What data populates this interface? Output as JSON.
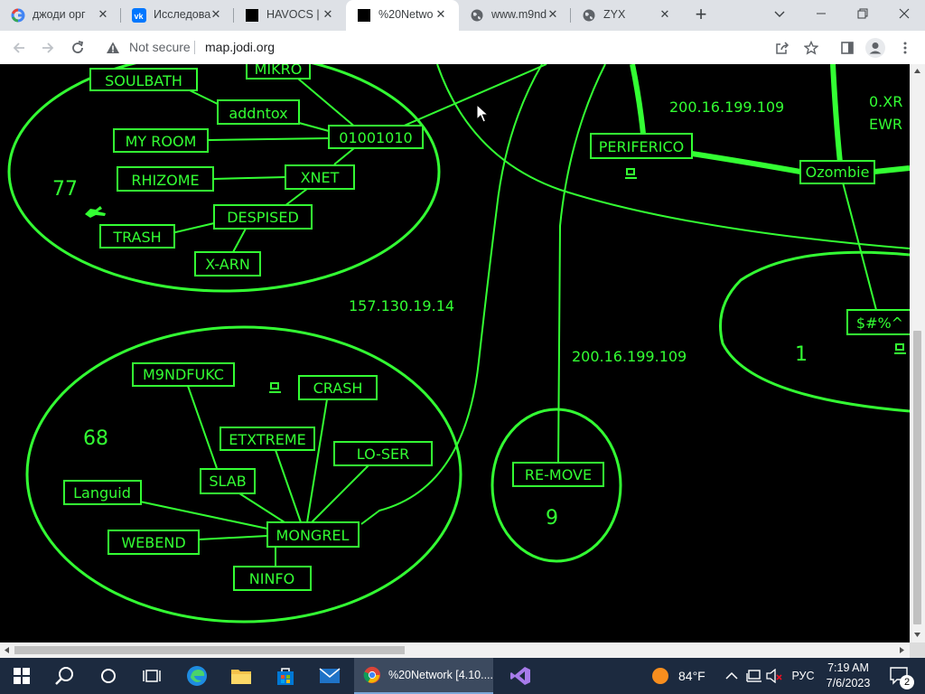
{
  "browser": {
    "tabs": [
      {
        "title": "джоди орг",
        "favicon": "google-g-icon"
      },
      {
        "title": "Исследова",
        "favicon": "vk-icon"
      },
      {
        "title": "HAVOCS | ",
        "favicon": "black-square-icon"
      },
      {
        "title": "%20Netwo",
        "favicon": "black-square-icon"
      },
      {
        "title": "www.m9nd",
        "favicon": "globe-icon"
      },
      {
        "title": "ZYX",
        "favicon": "globe-icon"
      }
    ],
    "address": {
      "security": "Not secure",
      "url": "map.jodi.org"
    }
  },
  "map": {
    "nodes": {
      "mikro": "MIKRO",
      "soulbath": "SOULBATH",
      "addntox": "addntox",
      "myroom": "MY ROOM",
      "o1001010": "01001010",
      "rhizome": "RHIZOME",
      "xnet": "XNET",
      "despised": "DESPISED",
      "trash": "TRASH",
      "xarn": "X-ARN",
      "periferico": "PERIFERICO",
      "ozombie": "Ozombie",
      "symbols": "$#%^",
      "m9ndfukc": "M9NDFUKC",
      "crash": "CRASH",
      "etxtreme": "ETXTREME",
      "loser": "LO-SER",
      "slab": "SLAB",
      "languid": "Languid",
      "mongrel": "MONGREL",
      "webend": "WEBEND",
      "ninfo": "NINFO",
      "remove": "RE-MOVE"
    },
    "labels": {
      "ip1": "200.16.199.109",
      "ip2": "157.130.19.14",
      "ip3": "200.16.199.109",
      "edge1": "0.XR",
      "edge2": "EWR",
      "count77": "77",
      "count68": "68",
      "count9": "9",
      "count1": "1"
    }
  },
  "taskbar": {
    "active_app": "%20Network [4.10....",
    "weather": "84°F",
    "language": "РУС",
    "time": "7:19 AM",
    "date": "7/6/2023",
    "notifications": "2"
  }
}
